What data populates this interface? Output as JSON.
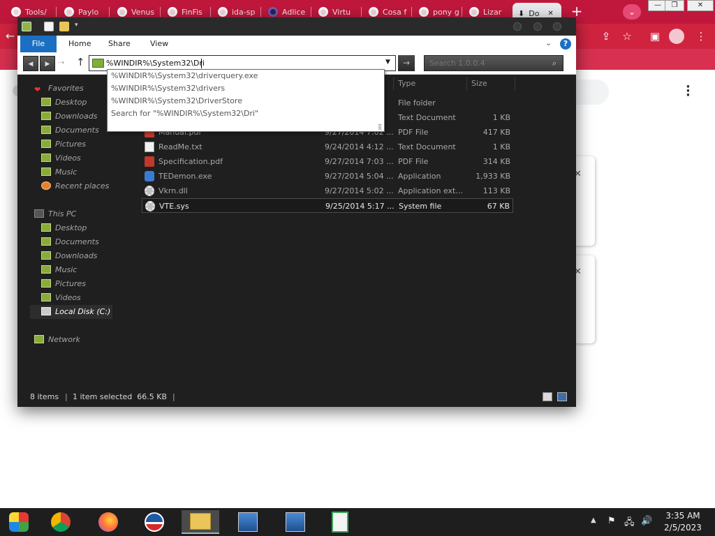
{
  "browser": {
    "tabs": [
      {
        "label": "Tools/",
        "icon": "chrome-tab-icon"
      },
      {
        "label": "Paylo",
        "icon": "chrome-tab-icon"
      },
      {
        "label": "Venus",
        "icon": "chrome-tab-icon"
      },
      {
        "label": "FinFis",
        "icon": "chrome-tab-icon"
      },
      {
        "label": "ida-sp",
        "icon": "chrome-tab-icon"
      },
      {
        "label": "Adlice",
        "icon": "adlice-icon"
      },
      {
        "label": "Virtu",
        "icon": "chrome-tab-icon"
      },
      {
        "label": "Cosa f",
        "icon": "chrome-tab-icon"
      },
      {
        "label": "pony g",
        "icon": "chrome-tab-icon"
      },
      {
        "label": "Lizar",
        "icon": "chrome-tab-icon"
      },
      {
        "label": "Do",
        "icon": "download-icon"
      }
    ],
    "tab_close": "✕",
    "new_tab": "+",
    "window_controls": {
      "minimize": "—",
      "restore": "❐",
      "close": "✕"
    }
  },
  "explorer": {
    "ribbon_tabs": {
      "file": "File",
      "home": "Home",
      "share": "Share",
      "view": "View"
    },
    "address": {
      "value": "%WINDIR%\\System32\\Dri"
    },
    "search": {
      "placeholder": "Search 1.0.0.4"
    },
    "autocomplete": [
      "%WINDIR%\\System32\\driverquery.exe",
      "%WINDIR%\\System32\\drivers",
      "%WINDIR%\\System32\\DriverStore",
      "Search for \"%WINDIR%\\System32\\Dri\""
    ],
    "nav": {
      "favorites": "Favorites",
      "fav_items": [
        "Desktop",
        "Downloads",
        "Documents",
        "Pictures",
        "Videos",
        "Music",
        "Recent places"
      ],
      "this_pc": "This PC",
      "pc_items": [
        "Desktop",
        "Documents",
        "Downloads",
        "Music",
        "Pictures",
        "Videos",
        "Local Disk (C:)"
      ],
      "network": "Network"
    },
    "columns": {
      "type": "Type",
      "size": "Size"
    },
    "files": [
      {
        "name": "",
        "date": "",
        "type": "File folder",
        "size": ""
      },
      {
        "name": "",
        "date": "",
        "type": "Text Document",
        "size": "1 KB"
      },
      {
        "name": "Manual.pdf",
        "date": "9/27/2014 7:02 ...",
        "type": "PDF File",
        "size": "417 KB"
      },
      {
        "name": "ReadMe.txt",
        "date": "9/24/2014 4:12 ...",
        "type": "Text Document",
        "size": "1 KB"
      },
      {
        "name": "Specification.pdf",
        "date": "9/27/2014 7:03 ...",
        "type": "PDF File",
        "size": "314 KB"
      },
      {
        "name": "TEDemon.exe",
        "date": "9/27/2014 5:04 ...",
        "type": "Application",
        "size": "1,933 KB"
      },
      {
        "name": "Vkrn.dll",
        "date": "9/27/2014 5:02 ...",
        "type": "Application ext...",
        "size": "113 KB"
      },
      {
        "name": "VTE.sys",
        "date": "9/25/2014 5:17 ...",
        "type": "System file",
        "size": "67 KB"
      }
    ],
    "status": {
      "items": "8 items",
      "selected": "1 item selected  66.5 KB",
      "sep": "|"
    }
  },
  "taskbar": {
    "time": "3:35 AM",
    "date": "2/5/2023"
  },
  "colors": {
    "chrome_tabstrip": "#c0183c",
    "chrome_toolbar": "#d0233f",
    "explorer_bg": "#1f1f1f",
    "ribbon_file_tab": "#1b6fc2",
    "taskbar": "#1e1e1e"
  }
}
